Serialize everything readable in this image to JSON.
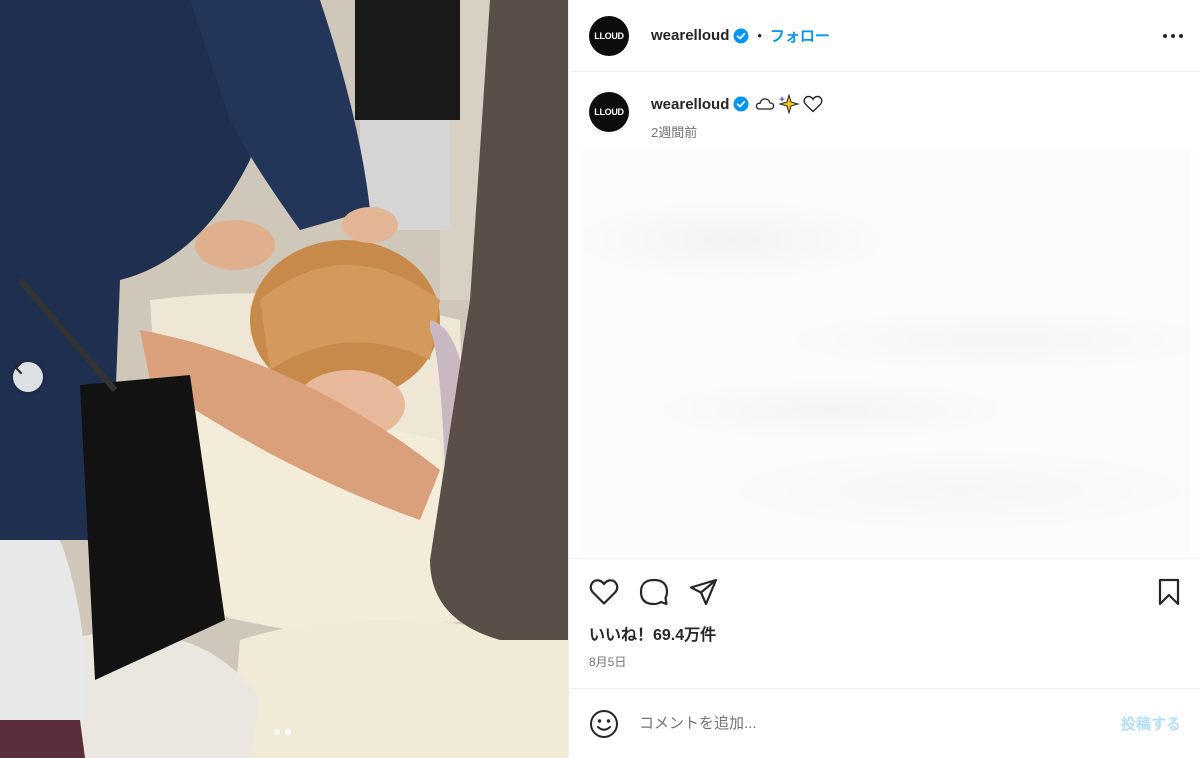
{
  "header": {
    "avatar_text": "LLOUD",
    "username": "wearelloud",
    "separator": "•",
    "follow_label": "フォロー",
    "more_icon": "more-horizontal-icon"
  },
  "caption": {
    "avatar_text": "LLOUD",
    "username": "wearelloud",
    "emojis": [
      "cloud-icon",
      "sparkles-icon",
      "white-heart-icon"
    ],
    "time": "2週間前"
  },
  "actions": {
    "icons": [
      "heart-icon",
      "comment-icon",
      "share-icon",
      "bookmark-icon"
    ],
    "likes": "いいね！69.4万件",
    "date": "8月5日"
  },
  "comment": {
    "placeholder": "コメントを追加...",
    "post_label": "投稿する",
    "emoji_icon": "emoji-icon"
  },
  "media": {
    "carousel_total": 2,
    "carousel_current": 2,
    "prev_icon": "chevron-left-icon"
  },
  "colors": {
    "accent": "#0095f6",
    "verified": "#0095f6",
    "post_disabled": "#b2dffc",
    "muted_text": "#737373",
    "border": "#efefef"
  }
}
